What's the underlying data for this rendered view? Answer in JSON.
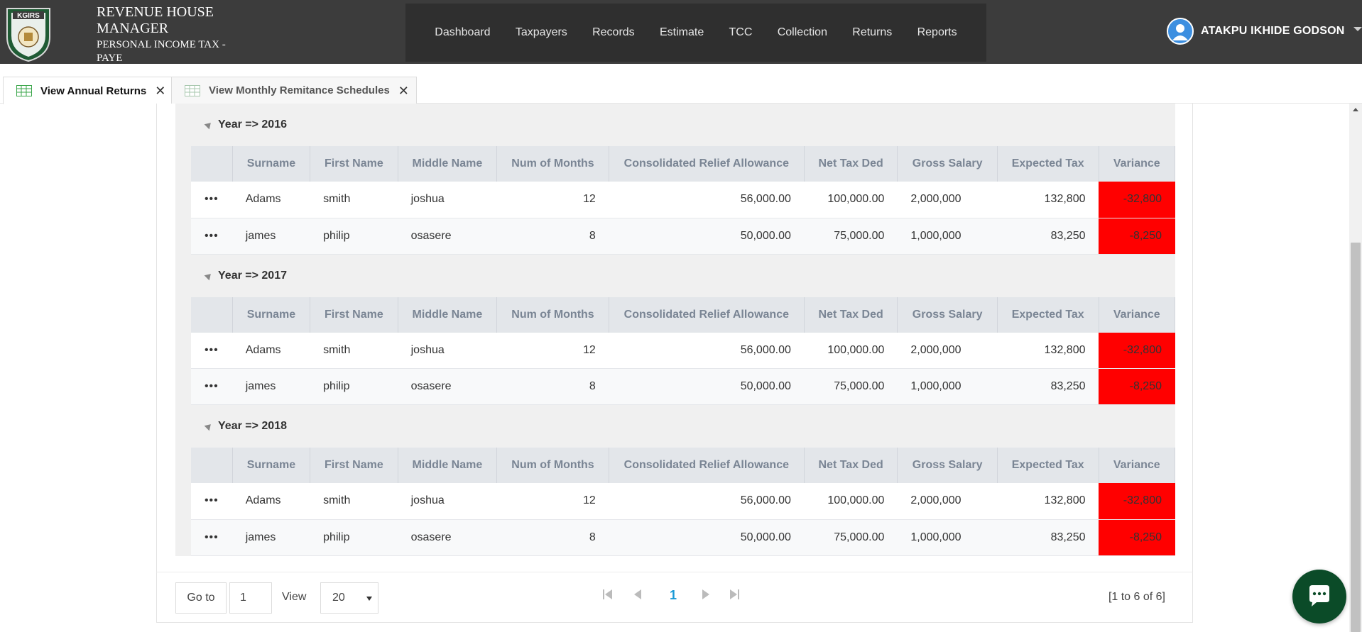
{
  "header": {
    "logo_text": "KGIRS",
    "app_title_line1": "REVENUE HOUSE MANAGER",
    "app_title_line2": "PERSONAL INCOME TAX - PAYE",
    "nav": [
      "Dashboard",
      "Taxpayers",
      "Records",
      "Estimate",
      "TCC",
      "Collection",
      "Returns",
      "Reports"
    ],
    "user_name": "ATAKPU IKHIDE GODSON",
    "colors": {
      "bar": "#3c3c3c",
      "nav_bg": "#2f2f2f",
      "avatar": "#3d8fe0"
    }
  },
  "tabs": [
    {
      "label": "View Annual Returns",
      "icon": "spreadsheet-icon",
      "active": true
    },
    {
      "label": "View Monthly Remitance Schedules",
      "icon": "spreadsheet-icon",
      "active": false
    }
  ],
  "grid": {
    "columns": [
      "Surname",
      "First Name",
      "Middle Name",
      "Num of Months",
      "Consolidated Relief Allowance",
      "Net Tax Ded",
      "Gross Salary",
      "Expected Tax",
      "Variance"
    ],
    "row_menu_glyph": "•••",
    "variance_color": "#ff0000",
    "groups": [
      {
        "title": "Year => 2016",
        "rows": [
          {
            "surname": "Adams",
            "first_name": "smith",
            "middle_name": "joshua",
            "months": "12",
            "cra": "56,000.00",
            "net_tax_ded": "100,000.00",
            "gross_salary": "2,000,000",
            "expected_tax": "132,800",
            "variance": "-32,800"
          },
          {
            "surname": "james",
            "first_name": "philip",
            "middle_name": "osasere",
            "months": "8",
            "cra": "50,000.00",
            "net_tax_ded": "75,000.00",
            "gross_salary": "1,000,000",
            "expected_tax": "83,250",
            "variance": "-8,250"
          }
        ]
      },
      {
        "title": "Year => 2017",
        "rows": [
          {
            "surname": "Adams",
            "first_name": "smith",
            "middle_name": "joshua",
            "months": "12",
            "cra": "56,000.00",
            "net_tax_ded": "100,000.00",
            "gross_salary": "2,000,000",
            "expected_tax": "132,800",
            "variance": "-32,800"
          },
          {
            "surname": "james",
            "first_name": "philip",
            "middle_name": "osasere",
            "months": "8",
            "cra": "50,000.00",
            "net_tax_ded": "75,000.00",
            "gross_salary": "1,000,000",
            "expected_tax": "83,250",
            "variance": "-8,250"
          }
        ]
      },
      {
        "title": "Year => 2018",
        "rows": [
          {
            "surname": "Adams",
            "first_name": "smith",
            "middle_name": "joshua",
            "months": "12",
            "cra": "56,000.00",
            "net_tax_ded": "100,000.00",
            "gross_salary": "2,000,000",
            "expected_tax": "132,800",
            "variance": "-32,800"
          },
          {
            "surname": "james",
            "first_name": "philip",
            "middle_name": "osasere",
            "months": "8",
            "cra": "50,000.00",
            "net_tax_ded": "75,000.00",
            "gross_salary": "1,000,000",
            "expected_tax": "83,250",
            "variance": "-8,250"
          }
        ]
      }
    ]
  },
  "pager": {
    "goto_label": "Go to",
    "goto_value": "1",
    "view_label": "View",
    "page_size": "20",
    "current_page": "1",
    "summary": "[1 to 6 of 6]",
    "buttons": [
      "first-page-icon",
      "prev-page-icon",
      "next-page-icon",
      "last-page-icon"
    ]
  },
  "chat_button": {
    "icon": "chat-bubble-icon",
    "color": "#0b4b28"
  }
}
